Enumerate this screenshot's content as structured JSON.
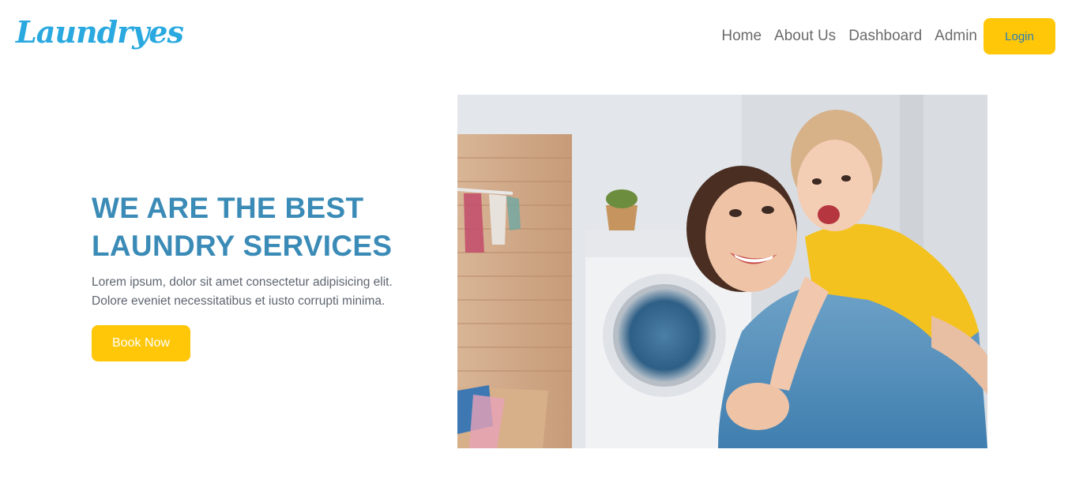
{
  "brand": {
    "name": "Laundryes",
    "color": "#29a9df"
  },
  "nav": {
    "items": [
      {
        "label": "Home"
      },
      {
        "label": "About Us"
      },
      {
        "label": "Dashboard"
      },
      {
        "label": "Admin"
      }
    ],
    "login_label": "Login"
  },
  "hero": {
    "title_line1": "WE ARE THE BEST",
    "title_line2": "LAUNDRY SERVICES",
    "desc_line1": "Lorem ipsum, dolor sit amet consectetur adipisicing elit.",
    "desc_line2": "Dolore eveniet necessitatibus et iusto corrupti minima.",
    "cta_label": "Book Now"
  },
  "colors": {
    "accent": "#ffc708",
    "title": "#3b8bb7",
    "link": "#6b6b6b"
  }
}
